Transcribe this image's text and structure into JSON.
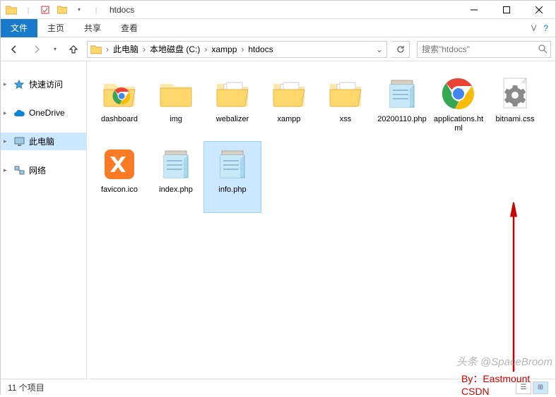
{
  "window": {
    "title": "htdocs"
  },
  "ribbon": {
    "tabs": {
      "file": "文件",
      "home": "主页",
      "share": "共享",
      "view": "查看"
    }
  },
  "breadcrumb": {
    "items": [
      "此电脑",
      "本地磁盘 (C:)",
      "xampp",
      "htdocs"
    ]
  },
  "search": {
    "placeholder": "搜索\"htdocs\""
  },
  "sidebar": {
    "items": [
      {
        "label": "快速访问",
        "icon": "star"
      },
      {
        "label": "OneDrive",
        "icon": "cloud"
      },
      {
        "label": "此电脑",
        "icon": "pc",
        "selected": true
      },
      {
        "label": "网络",
        "icon": "network"
      }
    ]
  },
  "files": [
    {
      "name": "dashboard",
      "type": "folder"
    },
    {
      "name": "img",
      "type": "folder"
    },
    {
      "name": "webalizer",
      "type": "folder"
    },
    {
      "name": "xampp",
      "type": "folder"
    },
    {
      "name": "xss",
      "type": "folder"
    },
    {
      "name": "20200110.php",
      "type": "notepad"
    },
    {
      "name": "applications.html",
      "type": "chrome"
    },
    {
      "name": "bitnami.css",
      "type": "gear"
    },
    {
      "name": "favicon.ico",
      "type": "xampp"
    },
    {
      "name": "index.php",
      "type": "notepad"
    },
    {
      "name": "info.php",
      "type": "notepad",
      "selected": true
    }
  ],
  "annotation": {
    "byline": "By：Eastmount CSDN"
  },
  "watermark": "头条 @SpaceBroom",
  "status": {
    "count": "11 个项目"
  }
}
